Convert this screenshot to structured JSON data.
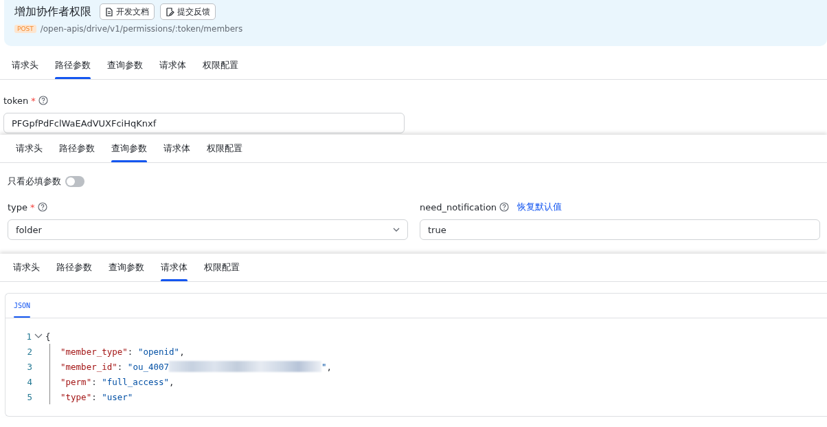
{
  "header": {
    "title": "增加协作者权限",
    "buttons": [
      {
        "label": "开发文档",
        "kind": "docs"
      },
      {
        "label": "提交反馈",
        "kind": "feedback"
      }
    ],
    "method": "POST",
    "path": "/open-apis/drive/v1/permissions/:token/members"
  },
  "panels": [
    {
      "kind": "path",
      "tabs": [
        {
          "label": "请求头",
          "selected": false
        },
        {
          "label": "路径参数",
          "selected": true
        },
        {
          "label": "查询参数",
          "selected": false
        },
        {
          "label": "请求体",
          "selected": false
        },
        {
          "label": "权限配置",
          "selected": false
        }
      ],
      "fields": [
        {
          "kind": "input",
          "name": "token",
          "required_mark": "*",
          "value": "PFGpfPdFclWaEAdVUXFciHqKnxf"
        }
      ]
    },
    {
      "kind": "query",
      "tabs": [
        {
          "label": "请求头",
          "selected": false
        },
        {
          "label": "路径参数",
          "selected": false
        },
        {
          "label": "查询参数",
          "selected": true
        },
        {
          "label": "请求体",
          "selected": false
        },
        {
          "label": "权限配置",
          "selected": false
        }
      ],
      "filter": {
        "label": "只看必填参数",
        "on": false
      },
      "fields": [
        {
          "kind": "select",
          "name": "type",
          "required_mark": "*",
          "value": "folder"
        },
        {
          "kind": "input",
          "name": "need_notification",
          "value": "true",
          "reset_link": "恢复默认值"
        }
      ]
    },
    {
      "kind": "body",
      "tabs": [
        {
          "label": "请求头",
          "selected": false
        },
        {
          "label": "路径参数",
          "selected": false
        },
        {
          "label": "查询参数",
          "selected": false
        },
        {
          "label": "请求体",
          "selected": true
        },
        {
          "label": "权限配置",
          "selected": false
        }
      ],
      "editor": {
        "tabs": [
          {
            "label": "JSON",
            "selected": true
          }
        ],
        "lines": [
          {
            "number": "1",
            "expanded": true,
            "parts": [
              {
                "kind": "punct",
                "text": "{"
              }
            ],
            "children": [
              {
                "number": "2",
                "parts": [
                  {
                    "kind": "key",
                    "text": "\"member_type\""
                  },
                  {
                    "kind": "punct",
                    "text": ": "
                  },
                  {
                    "kind": "string",
                    "text": "\"openid\""
                  },
                  {
                    "kind": "punct",
                    "text": ","
                  }
                ]
              },
              {
                "number": "3",
                "parts": [
                  {
                    "kind": "key",
                    "text": "\"member_id\""
                  },
                  {
                    "kind": "punct",
                    "text": ": "
                  },
                  {
                    "kind": "string",
                    "text": "\"ou_4007"
                  },
                  {
                    "kind": "redacted"
                  },
                  {
                    "kind": "string",
                    "text": "\""
                  },
                  {
                    "kind": "punct",
                    "text": ","
                  }
                ]
              },
              {
                "number": "4",
                "parts": [
                  {
                    "kind": "key",
                    "text": "\"perm\""
                  },
                  {
                    "kind": "punct",
                    "text": ": "
                  },
                  {
                    "kind": "string",
                    "text": "\"full_access\""
                  },
                  {
                    "kind": "punct",
                    "text": ","
                  }
                ]
              },
              {
                "number": "5",
                "parts": [
                  {
                    "kind": "key",
                    "text": "\"type\""
                  },
                  {
                    "kind": "punct",
                    "text": ": "
                  },
                  {
                    "kind": "string",
                    "text": "\"user\""
                  }
                ]
              }
            ]
          }
        ]
      }
    }
  ]
}
